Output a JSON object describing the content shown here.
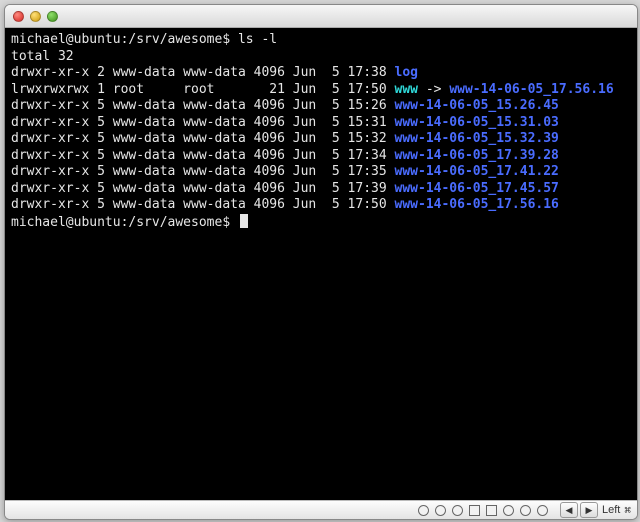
{
  "prompt_user": "michael",
  "prompt_host": "ubuntu",
  "prompt_path": "/srv/awesome",
  "prompt_suffix": "$ ",
  "command": "ls -l",
  "total_line": "total 32",
  "entries": [
    {
      "perms": "drwxr-xr-x",
      "links": "2",
      "owner": "www-data",
      "group": "www-data",
      "size": "4096",
      "month": "Jun",
      "day": " 5",
      "time": "17:38",
      "name": "log",
      "type": "dir"
    },
    {
      "perms": "lrwxrwxrwx",
      "links": "1",
      "owner": "root    ",
      "group": "root    ",
      "size": "  21",
      "month": "Jun",
      "day": " 5",
      "time": "17:50",
      "name": "www",
      "type": "link",
      "target": "www-14-06-05_17.56.16"
    },
    {
      "perms": "drwxr-xr-x",
      "links": "5",
      "owner": "www-data",
      "group": "www-data",
      "size": "4096",
      "month": "Jun",
      "day": " 5",
      "time": "15:26",
      "name": "www-14-06-05_15.26.45",
      "type": "dir"
    },
    {
      "perms": "drwxr-xr-x",
      "links": "5",
      "owner": "www-data",
      "group": "www-data",
      "size": "4096",
      "month": "Jun",
      "day": " 5",
      "time": "15:31",
      "name": "www-14-06-05_15.31.03",
      "type": "dir"
    },
    {
      "perms": "drwxr-xr-x",
      "links": "5",
      "owner": "www-data",
      "group": "www-data",
      "size": "4096",
      "month": "Jun",
      "day": " 5",
      "time": "15:32",
      "name": "www-14-06-05_15.32.39",
      "type": "dir"
    },
    {
      "perms": "drwxr-xr-x",
      "links": "5",
      "owner": "www-data",
      "group": "www-data",
      "size": "4096",
      "month": "Jun",
      "day": " 5",
      "time": "17:34",
      "name": "www-14-06-05_17.39.28",
      "type": "dir"
    },
    {
      "perms": "drwxr-xr-x",
      "links": "5",
      "owner": "www-data",
      "group": "www-data",
      "size": "4096",
      "month": "Jun",
      "day": " 5",
      "time": "17:35",
      "name": "www-14-06-05_17.41.22",
      "type": "dir"
    },
    {
      "perms": "drwxr-xr-x",
      "links": "5",
      "owner": "www-data",
      "group": "www-data",
      "size": "4096",
      "month": "Jun",
      "day": " 5",
      "time": "17:39",
      "name": "www-14-06-05_17.45.57",
      "type": "dir"
    },
    {
      "perms": "drwxr-xr-x",
      "links": "5",
      "owner": "www-data",
      "group": "www-data",
      "size": "4096",
      "month": "Jun",
      "day": " 5",
      "time": "17:50",
      "name": "www-14-06-05_17.56.16",
      "type": "dir"
    }
  ],
  "statusbar": {
    "arrow_prev": "◀",
    "arrow_next": "▶",
    "label": "Left",
    "cmd_symbol": "⌘"
  }
}
